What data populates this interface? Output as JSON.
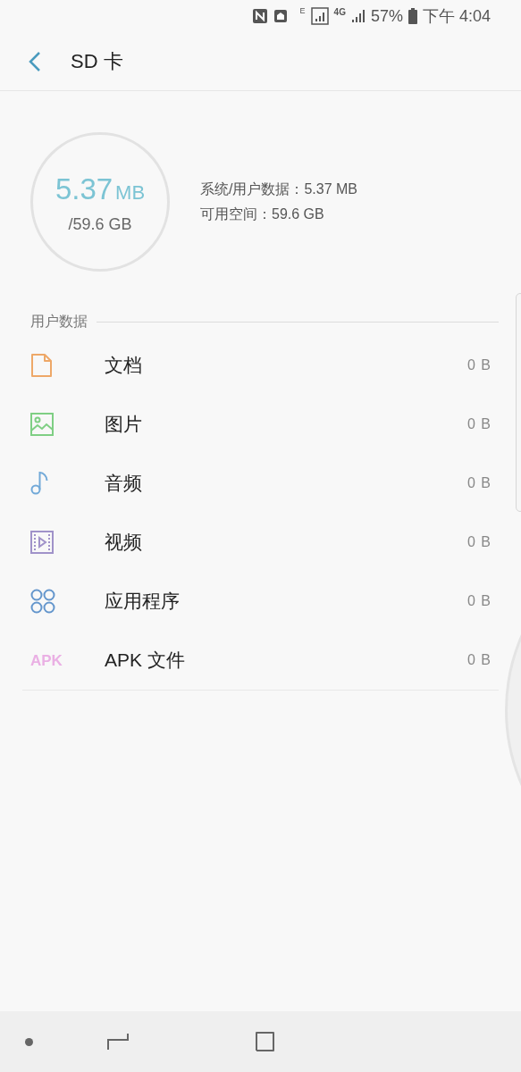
{
  "status_bar": {
    "battery": "57%",
    "time": "下午 4:04",
    "network": "4G",
    "network_small": "E"
  },
  "header": {
    "title": "SD 卡"
  },
  "storage": {
    "used": "5.37",
    "used_unit": "MB",
    "total": "/59.6 GB",
    "lines": [
      "系统/用户数据：5.37 MB",
      "可用空间：59.6 GB"
    ]
  },
  "section": {
    "title": "用户数据"
  },
  "items": [
    {
      "kind": "document",
      "label": "文档",
      "size": "0 B",
      "color": "#eea868"
    },
    {
      "kind": "image",
      "label": "图片",
      "size": "0 B",
      "color": "#7fcf84"
    },
    {
      "kind": "audio",
      "label": "音频",
      "size": "0 B",
      "color": "#72a9d8"
    },
    {
      "kind": "video",
      "label": "视频",
      "size": "0 B",
      "color": "#a092c9"
    },
    {
      "kind": "apps",
      "label": "应用程序",
      "size": "0 B",
      "color": "#6496cc"
    },
    {
      "kind": "apk",
      "label": "APK 文件",
      "size": "0 B",
      "color": "#eab0e4",
      "icon_text": "APK"
    }
  ]
}
